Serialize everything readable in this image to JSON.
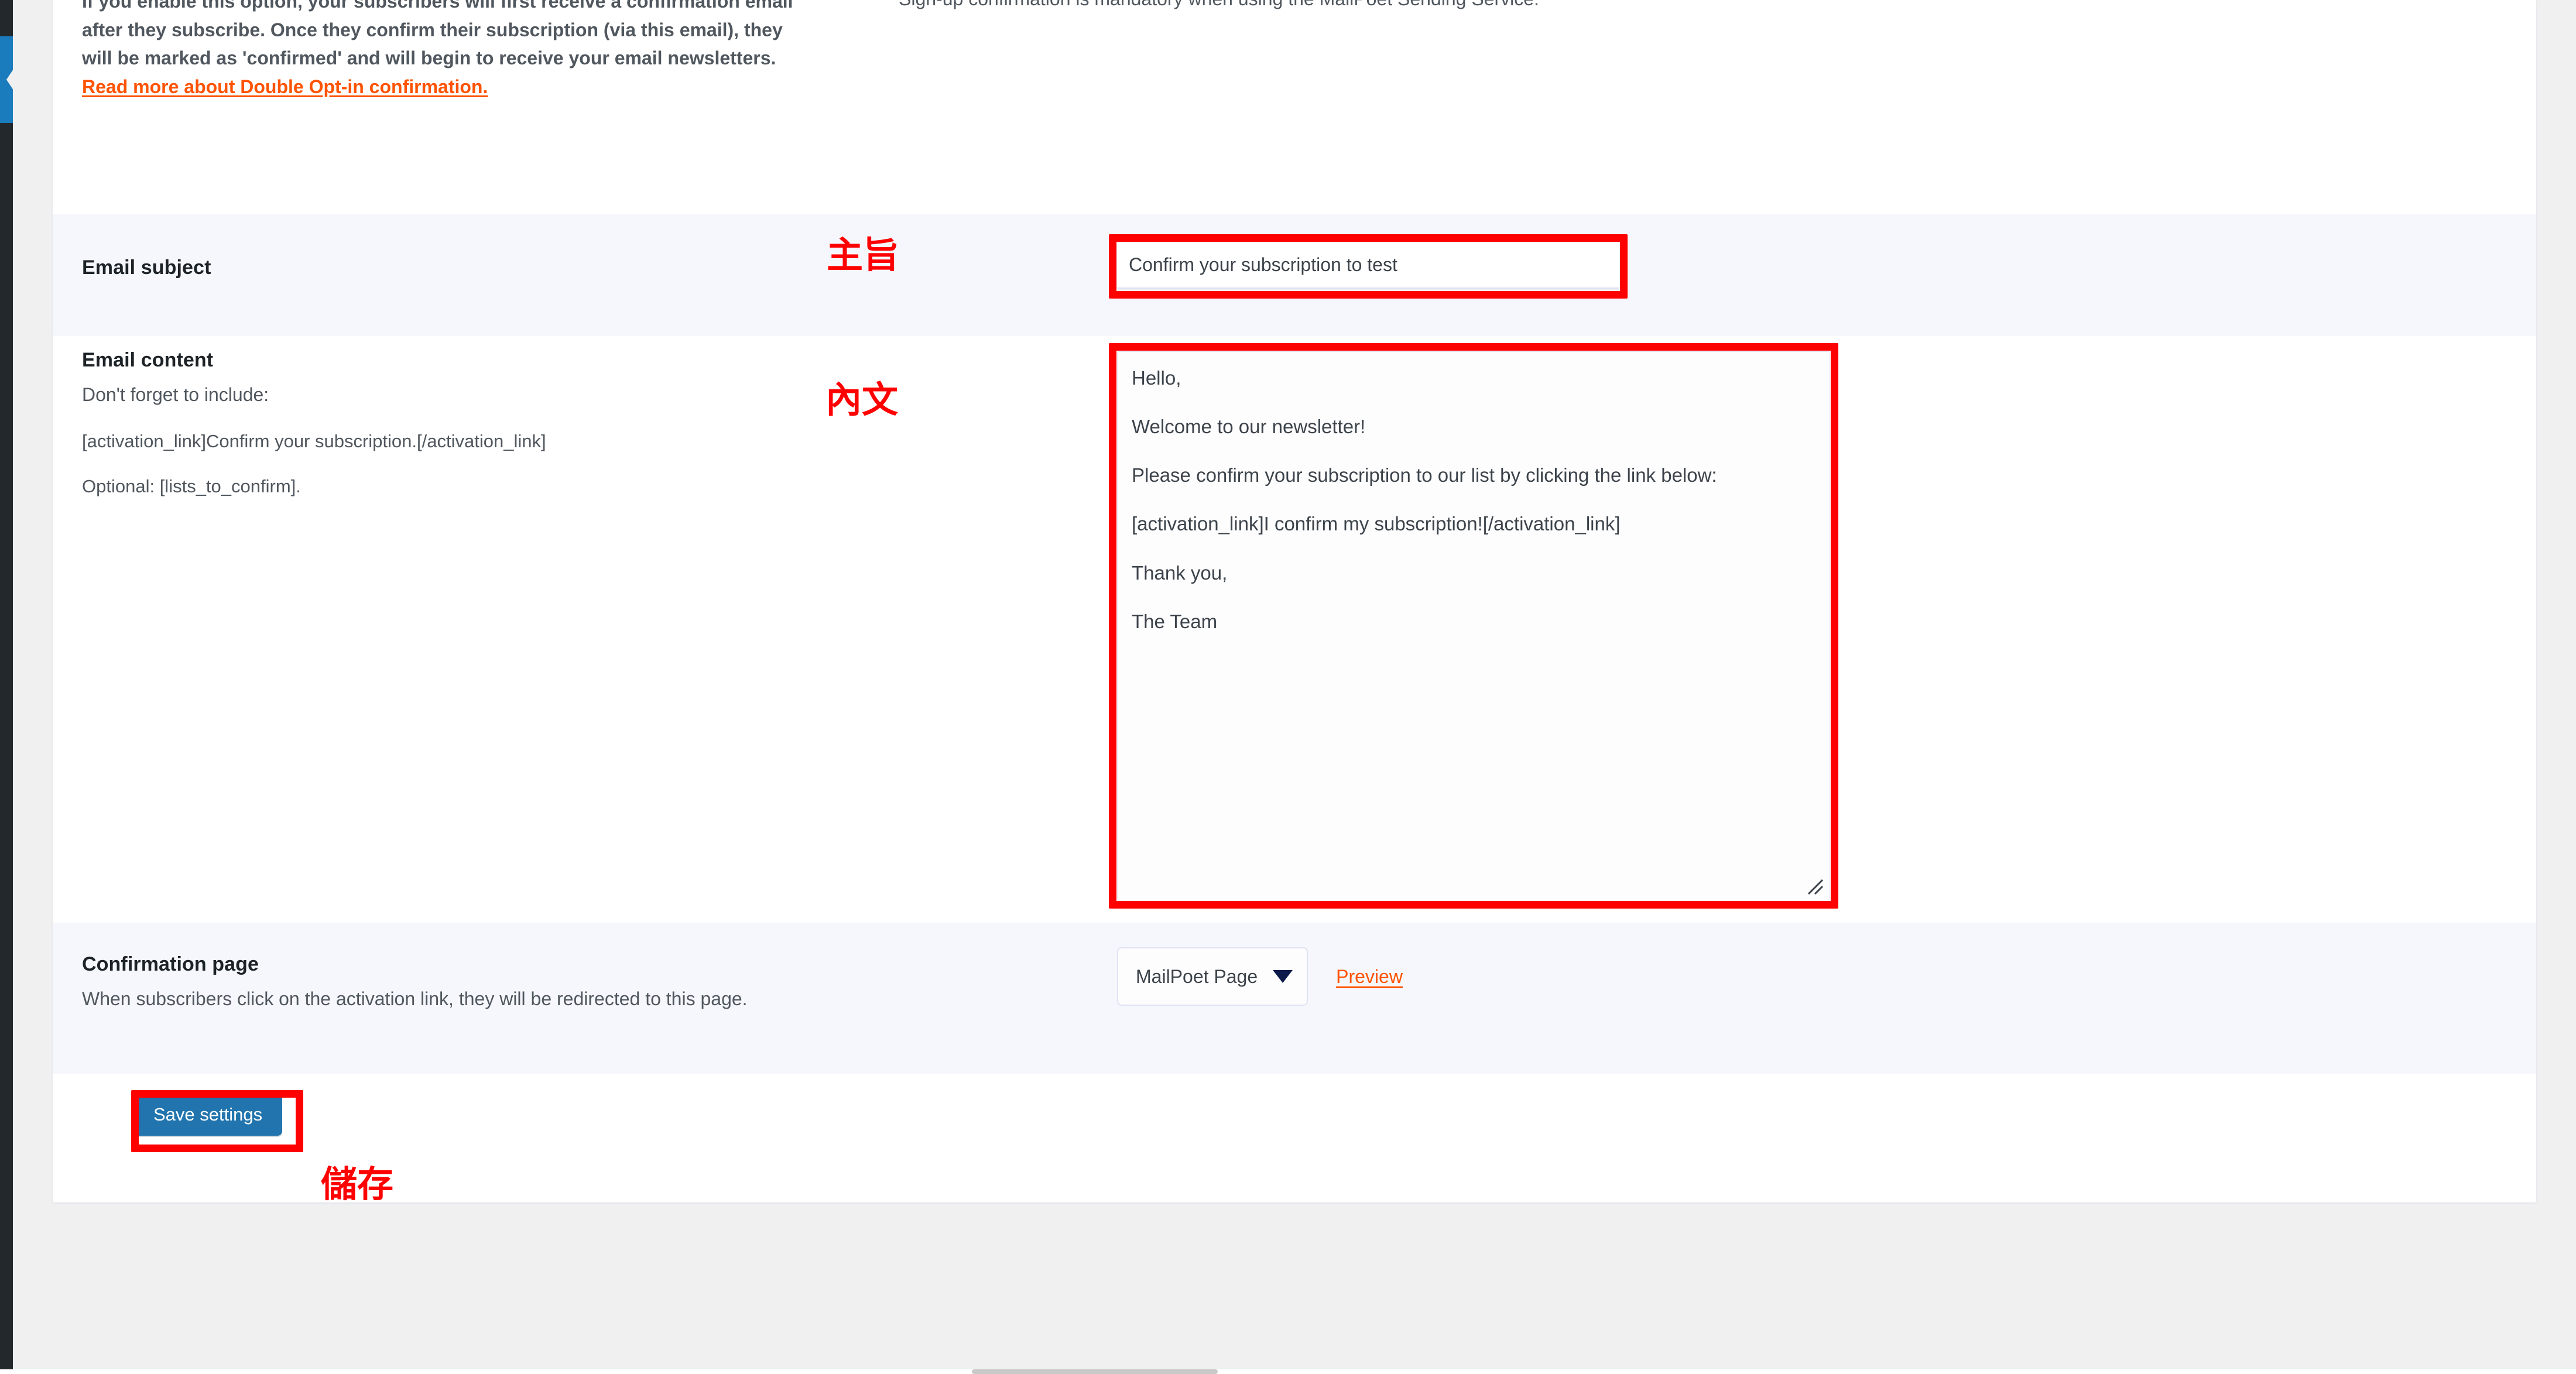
{
  "intro": {
    "left_html_text": "If you enable this option, your subscribers will first receive a confirmation email after they subscribe. Once they confirm their subscription (via this email), they will be marked as 'confirmed' and will begin to receive your email newsletters.",
    "left_link_text": "Read more about Double Opt-in confirmation.",
    "right_text": "Sign-up confirmation is mandatory when using the MailPoet Sending Service."
  },
  "subject_row": {
    "label": "Email subject",
    "value": "Confirm your subscription to test",
    "placeholder": "Confirm your subscription to test",
    "annotation_cjk": "主旨"
  },
  "content_row": {
    "label": "Email content",
    "desc": "Don't forget to include:",
    "hint_required": "[activation_link]Confirm your subscription.[/activation_link]",
    "hint_optional": "Optional: [lists_to_confirm].",
    "value": "Hello,\n\nWelcome to our newsletter!\n\nPlease confirm your subscription to our list by clicking the link below:\n\n[activation_link]I confirm my subscription![/activation_link]\n\nThank you,\n\nThe Team",
    "annotation_cjk": "內文"
  },
  "confirmation_row": {
    "label": "Confirmation page",
    "desc": "When subscribers click on the activation link, they will be redirected to this page.",
    "selected_option": "MailPoet Page",
    "options": [
      "MailPoet Page"
    ],
    "preview_link": "Preview"
  },
  "save_row": {
    "button_label": "Save settings",
    "annotation_cjk": "儲存"
  },
  "colors": {
    "annotation_red": "#fe0000",
    "link_orange": "#ff5301",
    "primary_blue": "#2174ad",
    "row_tint": "#f5f7fc",
    "admin_dark": "#23282d",
    "admin_active_blue": "#1b7cbd"
  }
}
